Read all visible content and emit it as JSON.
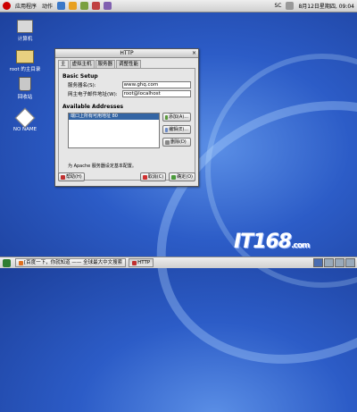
{
  "top_panel": {
    "menu_applications": "应用程序",
    "menu_actions": "动作",
    "input_method": "SC",
    "clock": "8月12日星期四, 09:04"
  },
  "desktop": {
    "icons": [
      {
        "label": "计算机"
      },
      {
        "label": "root 的主目录"
      },
      {
        "label": "回收站"
      },
      {
        "label": "NO NAME"
      }
    ]
  },
  "dialog": {
    "title": "HTTP",
    "close_glyph": "×",
    "tabs": [
      "主",
      "虚拟主机",
      "服务器",
      "调整性能"
    ],
    "basic_setup": "Basic Setup",
    "server_name_label": "服务器名(S):",
    "server_name_value": "www.ghq.com",
    "webmaster_label": "网主电子邮件地址(W):",
    "webmaster_value": "root@localhost",
    "available_addresses": "Available Addresses",
    "address_items": [
      "端口上所有可用地址 80"
    ],
    "add_button": "添加(A)...",
    "edit_button": "编辑(E)...",
    "delete_button": "删除(D)",
    "note": "为 Apache 服务器设定基本配置。",
    "help_button": "帮助(H)",
    "cancel_button": "取消(C)",
    "ok_button": "确定(O)"
  },
  "taskbar": {
    "items": [
      {
        "label": "[百度一下，你就知道 —— 全球最大中文搜索"
      },
      {
        "label": "HTTP"
      }
    ]
  },
  "watermark": {
    "text": "IT168",
    "suffix": ".com"
  },
  "colors": {
    "selection": "#3465a4",
    "desktop_blue": "#2c5cc7",
    "redhat_red": "#cc0000"
  }
}
